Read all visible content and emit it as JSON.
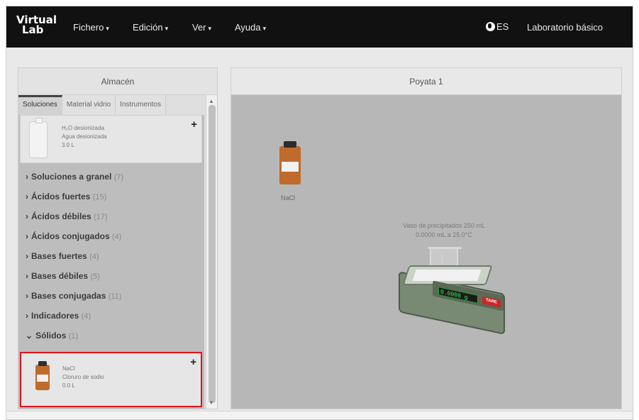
{
  "logo": {
    "line1": "Virtual",
    "line2": "Lab"
  },
  "menus": [
    {
      "label": "Fichero"
    },
    {
      "label": "Edición"
    },
    {
      "label": "Ver"
    },
    {
      "label": "Ayuda"
    }
  ],
  "language": "ES",
  "lab_name": "Laboratorio básico",
  "store": {
    "title": "Almacén",
    "tabs": [
      "Soluciones",
      "Material vidrio",
      "Instrumentos"
    ],
    "water": {
      "formula": "H₂O desionizada",
      "name": "Agua desionizada",
      "amount": "3.0 L"
    },
    "categories": [
      {
        "label": "Soluciones a granel",
        "count": "(7)"
      },
      {
        "label": "Ácidos fuertes",
        "count": "(15)"
      },
      {
        "label": "Ácidos débiles",
        "count": "(17)"
      },
      {
        "label": "Ácidos conjugados",
        "count": "(4)"
      },
      {
        "label": "Bases fuertes",
        "count": "(4)"
      },
      {
        "label": "Bases débiles",
        "count": "(5)"
      },
      {
        "label": "Bases conjugadas",
        "count": "(11)"
      },
      {
        "label": "Indicadores",
        "count": "(4)"
      },
      {
        "label": "Sólidos",
        "count": "(1)"
      }
    ],
    "nacl": {
      "formula": "NaCl",
      "name": "Cloruro de sodio",
      "amount": "0.0 L"
    },
    "plus": "+"
  },
  "bench": {
    "title": "Poyata 1",
    "bottle_label": "NaCl",
    "beaker_title": "Vaso de precipitados 250 mL",
    "beaker_info": "0.0000 mL a 25.0°C",
    "scale_display": "0.0000 g",
    "tare": "TARE"
  },
  "colors": {
    "navbar": "#111111",
    "bottle": "#c06a2b",
    "highlight": "#e0141b",
    "workspace": "#b7b7b7"
  }
}
